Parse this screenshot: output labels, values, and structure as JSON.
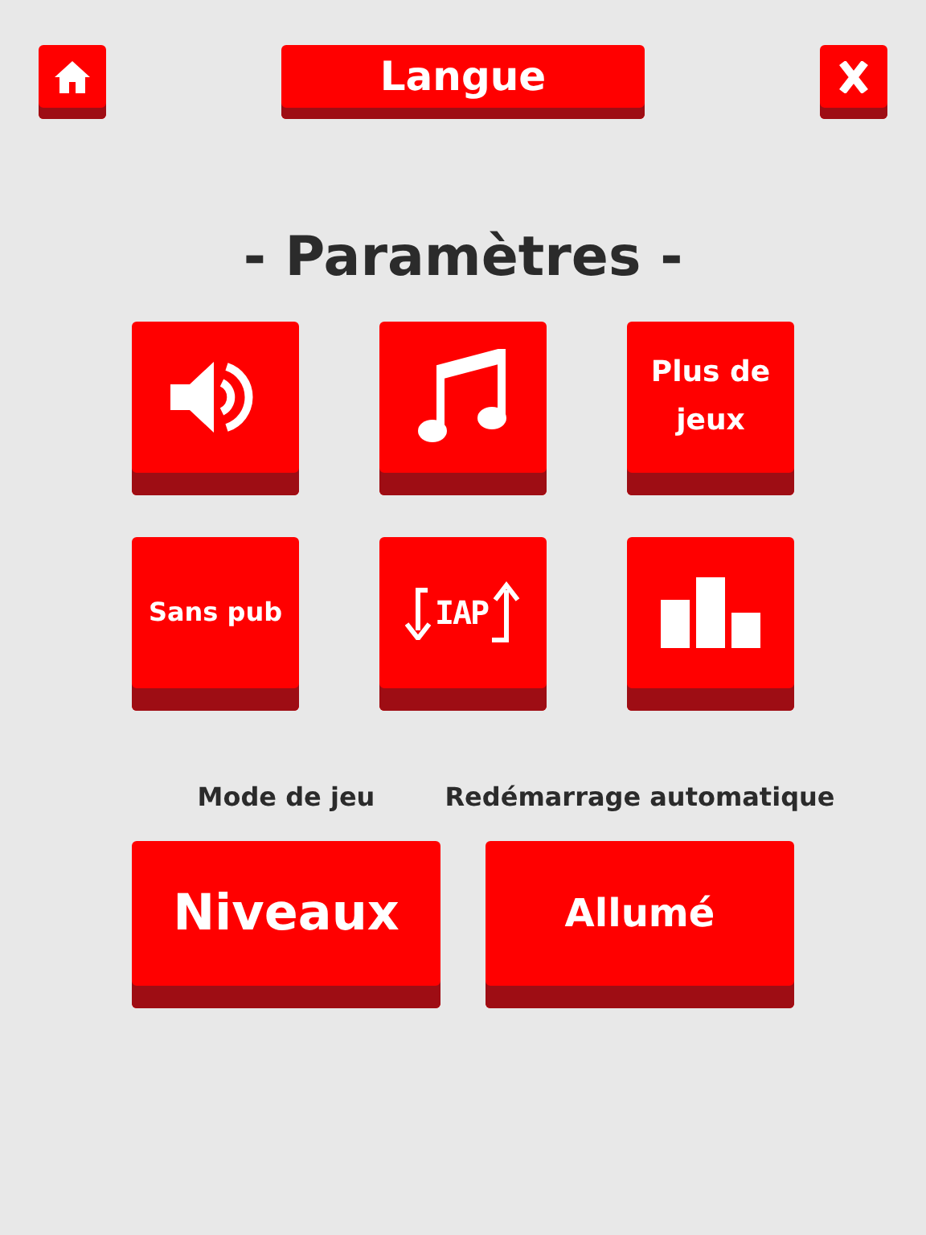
{
  "top_bar": {
    "language_button": "Langue"
  },
  "title": "- Paramètres -",
  "tiles": [
    {
      "kind": "sound"
    },
    {
      "kind": "music"
    },
    {
      "kind": "text",
      "label": "Plus de jeux"
    },
    {
      "kind": "text",
      "label": "Sans pub"
    },
    {
      "kind": "iap",
      "label": "IAP"
    },
    {
      "kind": "leaderboard"
    }
  ],
  "options": [
    {
      "label": "Mode de jeu",
      "value": "Niveaux"
    },
    {
      "label": "Redémarrage automatique",
      "value": "Allumé"
    }
  ]
}
